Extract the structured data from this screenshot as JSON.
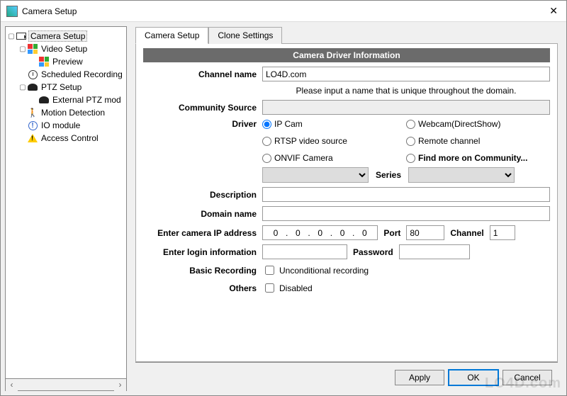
{
  "window": {
    "title": "Camera Setup",
    "close": "✕"
  },
  "tree": {
    "root": "Camera Setup",
    "video_setup": "Video Setup",
    "preview": "Preview",
    "scheduled": "Scheduled Recording",
    "ptz": "PTZ Setup",
    "external_ptz": "External PTZ mod",
    "motion": "Motion Detection",
    "io": "IO module",
    "access": "Access Control",
    "scroll_left": "‹",
    "scroll_right": "›"
  },
  "tabs": {
    "camera_setup": "Camera Setup",
    "clone": "Clone Settings"
  },
  "section": {
    "title": "Camera Driver Information"
  },
  "form": {
    "channel_name_label": "Channel name",
    "channel_name_value": "LO4D.com",
    "hint": "Please input a name that is unique throughout the domain.",
    "community_source_label": "Community Source",
    "community_source_value": "",
    "driver_label": "Driver",
    "drivers": {
      "ip_cam": "IP Cam",
      "webcam": "Webcam(DirectShow)",
      "rtsp": "RTSP video source",
      "remote": "Remote channel",
      "onvif": "ONVIF Camera",
      "community": "Find more on Community..."
    },
    "series_label": "Series",
    "description_label": "Description",
    "description_value": "",
    "domain_label": "Domain name",
    "domain_value": "",
    "ip_label": "Enter camera IP address",
    "ip": {
      "o1": "0",
      "o2": "0",
      "o3": "0",
      "o4": "0",
      "o5": "0"
    },
    "port_label": "Port",
    "port_value": "80",
    "channel_label": "Channel",
    "channel_value": "1",
    "login_label": "Enter login information",
    "login_value": "",
    "password_label": "Password",
    "password_value": "",
    "basic_rec_label": "Basic Recording",
    "basic_rec_check": "Unconditional recording",
    "others_label": "Others",
    "others_check": "Disabled"
  },
  "footer": {
    "apply": "Apply",
    "ok": "OK",
    "cancel": "Cancel"
  },
  "watermark": "LO4D.com"
}
